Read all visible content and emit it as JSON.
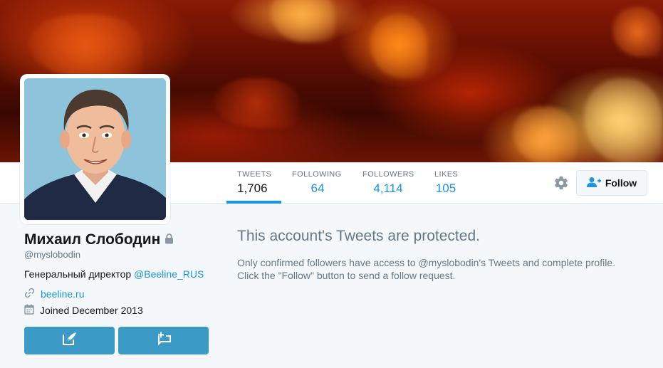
{
  "colors": {
    "accent": "#1b95e0",
    "button_blue": "#3c9ac7",
    "muted_text": "#657786",
    "background": "#f5f8fa"
  },
  "nav": {
    "stats": [
      {
        "label": "TWEETS",
        "value": "1,706",
        "active": true
      },
      {
        "label": "FOLLOWING",
        "value": "64",
        "active": false
      },
      {
        "label": "FOLLOWERS",
        "value": "4,114",
        "active": false
      },
      {
        "label": "LIKES",
        "value": "105",
        "active": false
      }
    ],
    "settings_icon": "gear-icon",
    "follow_label": "Follow",
    "follow_icon": "add-user-icon"
  },
  "profile": {
    "name": "Михаил Слободин",
    "lock_icon": "lock-icon",
    "handle": "@myslobodin",
    "bio_text": "Генеральный директор",
    "bio_mention": "@Beeline_RUS",
    "website": "beeline.ru",
    "website_icon": "link-icon",
    "joined": "Joined December 2013",
    "joined_icon": "calendar-icon",
    "actions": [
      {
        "name": "tweet-to-button",
        "icon": "compose-icon"
      },
      {
        "name": "message-button",
        "icon": "direct-message-icon"
      }
    ]
  },
  "protected": {
    "title": "This account's Tweets are protected.",
    "line1": "Only confirmed followers have access to @myslobodin's Tweets and complete profile.",
    "line2": "Click the \"Follow\" button to send a follow request."
  }
}
